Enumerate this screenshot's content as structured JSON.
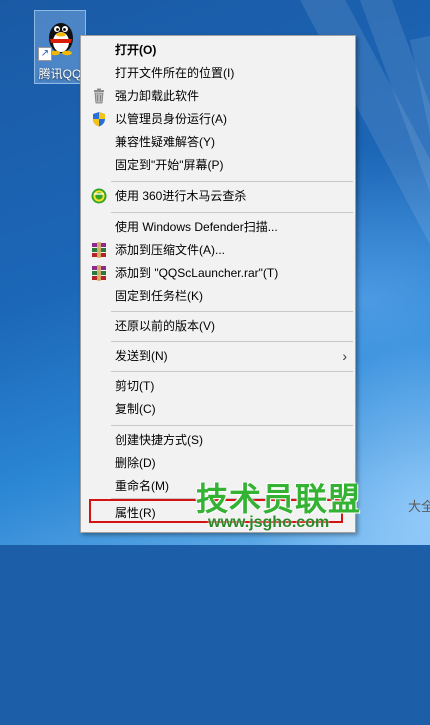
{
  "desktop": {
    "icon_label": "腾讯QQ"
  },
  "menu": {
    "items": [
      {
        "label": "打开(O)",
        "icon": null,
        "bold": true
      },
      {
        "label": "打开文件所在的位置(I)",
        "icon": null
      },
      {
        "label": "强力卸载此软件",
        "icon": "trash-can-icon"
      },
      {
        "label": "以管理员身份运行(A)",
        "icon": "uac-shield-icon"
      },
      {
        "label": "兼容性疑难解答(Y)",
        "icon": null
      },
      {
        "label": "固定到\"开始\"屏幕(P)",
        "icon": null
      },
      {
        "label": "使用 360进行木马云查杀",
        "icon": "360-logo-icon"
      },
      {
        "label": "使用 Windows Defender扫描...",
        "icon": null
      },
      {
        "label": "添加到压缩文件(A)...",
        "icon": "winrar-books-icon"
      },
      {
        "label": "添加到 \"QQScLauncher.rar\"(T)",
        "icon": "winrar-books-icon"
      },
      {
        "label": "固定到任务栏(K)",
        "icon": null
      },
      {
        "label": "还原以前的版本(V)",
        "icon": null
      },
      {
        "label": "发送到(N)",
        "icon": null,
        "submenu": true
      },
      {
        "label": "剪切(T)",
        "icon": null
      },
      {
        "label": "复制(C)",
        "icon": null
      },
      {
        "label": "创建快捷方式(S)",
        "icon": null
      },
      {
        "label": "删除(D)",
        "icon": null
      },
      {
        "label": "重命名(M)",
        "icon": null
      },
      {
        "label": "属性(R)",
        "icon": null,
        "highlighted": true
      }
    ],
    "submenu_arrow": "›"
  },
  "watermark": {
    "title": "技术员联盟",
    "url": "www.jsgho.com",
    "extra": "大全"
  },
  "colors": {
    "highlight": "#d41414",
    "watermark_green": "#33b233",
    "menu_bg": "#f2f2f2"
  }
}
